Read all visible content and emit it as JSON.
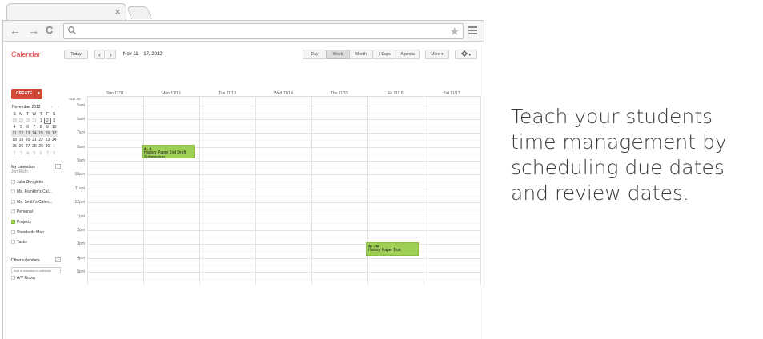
{
  "browser": {
    "tab_close": "×",
    "address_value": "",
    "nav": {
      "back": "←",
      "forward": "→",
      "reload": "C"
    },
    "star": "★"
  },
  "app": {
    "title": "Calendar"
  },
  "toolbar": {
    "today": "Today",
    "prev": "‹",
    "next": "›",
    "date_range": "Nov 11 – 17, 2012",
    "views": [
      "Day",
      "Week",
      "Month",
      "4 Days",
      "Agenda"
    ],
    "active_view": "Week",
    "more": "More ▾",
    "settings_caret": "▾"
  },
  "sidebar": {
    "create_label": "CREATE",
    "create_caret": "▾",
    "mini_calendar": {
      "title": "November 2012",
      "prev": "‹",
      "next": "›",
      "weekdays": [
        "S",
        "M",
        "T",
        "W",
        "T",
        "F",
        "S"
      ],
      "weeks": [
        [
          "28",
          "29",
          "30",
          "31",
          "1",
          "2",
          "3"
        ],
        [
          "4",
          "5",
          "6",
          "7",
          "8",
          "9",
          "10"
        ],
        [
          "11",
          "12",
          "13",
          "14",
          "15",
          "16",
          "17"
        ],
        [
          "18",
          "19",
          "20",
          "21",
          "22",
          "23",
          "24"
        ],
        [
          "25",
          "26",
          "27",
          "28",
          "29",
          "30",
          "1"
        ],
        [
          "2",
          "3",
          "4",
          "5",
          "6",
          "7",
          "8"
        ]
      ]
    },
    "my_calendars": {
      "header": "My calendars",
      "items": [
        "Jon Rishi",
        "Julia Googlette",
        "Ms. Franklin's Cal...",
        "Ms. Smith's Calen...",
        "Personal",
        "Projects",
        "Standards Map",
        "Tasks"
      ],
      "toggle": "▾"
    },
    "other_calendars": {
      "header": "Other calendars",
      "add_placeholder": "Add a coworker's calendar",
      "items": [
        "A/V Room"
      ],
      "toggle": "▾"
    }
  },
  "week": {
    "tz_label": "GMT-08",
    "days": [
      "Sun 11/11",
      "Mon 11/12",
      "Tue 11/13",
      "Wed 11/14",
      "Thu 11/15",
      "Fri 11/16",
      "Sat 11/17"
    ],
    "hours": [
      "5am",
      "6am",
      "7am",
      "8am",
      "9am",
      "10am",
      "11am",
      "12pm",
      "1pm",
      "2pm",
      "3pm",
      "4pm",
      "5pm"
    ]
  },
  "events": [
    {
      "time": "8 – 9",
      "title": "History Paper 2nd Draft Submission",
      "day": "Mon 11/12"
    },
    {
      "time": "3p – 4p",
      "title": "History Paper Due",
      "day": "Fri 11/16"
    }
  ],
  "colors": {
    "accent_red": "#dd4b39",
    "create_button": "#d14836",
    "event_green": "#9fce54"
  },
  "caption": "Teach your students time management by scheduling due dates and review dates."
}
